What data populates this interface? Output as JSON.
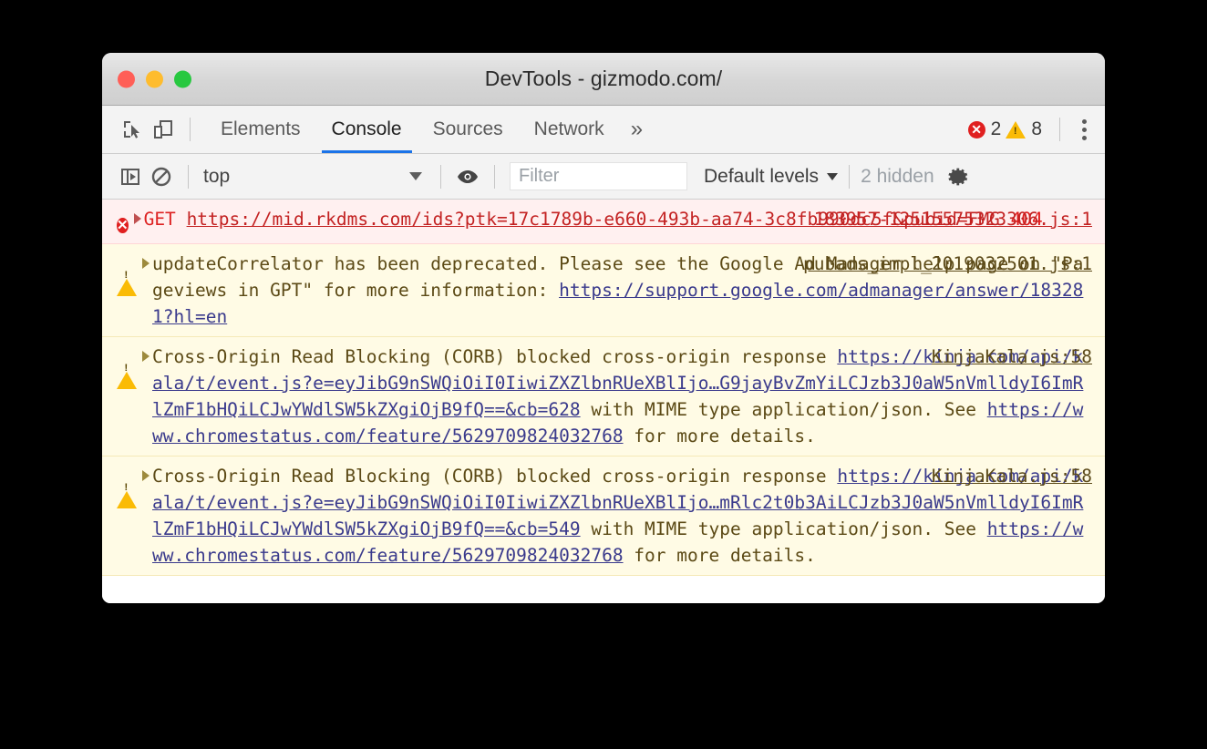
{
  "window": {
    "title": "DevTools - gizmodo.com/",
    "traffic_lights": [
      {
        "name": "close",
        "color": "#ff5f57"
      },
      {
        "name": "minimize",
        "color": "#febc2e"
      },
      {
        "name": "maximize",
        "color": "#28c840"
      }
    ]
  },
  "tabbar": {
    "inspect_icon": "inspect-element-icon",
    "device_icon": "device-toolbar-icon",
    "tabs": [
      {
        "label": "Elements",
        "active": false
      },
      {
        "label": "Console",
        "active": true
      },
      {
        "label": "Sources",
        "active": false
      },
      {
        "label": "Network",
        "active": false
      }
    ],
    "more_tabs_label": "»",
    "error_count": "2",
    "warning_count": "8",
    "error_badge_color": "#e02020",
    "warning_badge_color": "#fabb05",
    "menu_icon": "kebab-menu-icon",
    "active_tab_underline_color": "#1a73e8"
  },
  "consolebar": {
    "sidebar_icon": "show-console-sidebar-icon",
    "clear_icon": "clear-console-icon",
    "context": "top",
    "live_expression_icon": "eye-icon",
    "filter_placeholder": "Filter",
    "filter_value": "",
    "levels_label": "Default levels",
    "hidden_label": "2 hidden",
    "settings_icon": "gear-icon"
  },
  "console_messages": [
    {
      "level": "error",
      "icon": "error-circle-icon",
      "expander": "disclosure-triangle-icon",
      "method": "GET",
      "url": "https://mid.rkdms.com/ids?ptk=17c1789b-e660-493b-aa74-3c8fb990dc5f&pubid=FMG",
      "status": "404",
      "source": "183957-12515575323306.js:1",
      "background": "#fff0f0"
    },
    {
      "level": "warning",
      "icon": "warning-triangle-icon",
      "expander": "disclosure-triangle-icon",
      "text_before": "updateCorrelator has been deprecated. Please see the Google Ad Manager help page on \"Pageviews in GPT\" for more information: ",
      "url": "https://support.google.com/admanager/answer/183281?hl=en",
      "text_after": "",
      "source": "pubads_impl_2019032501.js:1",
      "background": "#fffbe5"
    },
    {
      "level": "warning",
      "icon": "warning-triangle-icon",
      "expander": "disclosure-triangle-icon",
      "text_before": "Cross-Origin Read Blocking (CORB) blocked cross-origin response ",
      "url": "https://kinja.com/api/kala/t/event.js?e=eyJibG9nSWQiOiI0IiwiZXZlbnRUeXBlIjo…G9jayBvZmYiLCJzb3J0aW5nVmlldyI6ImRlZmF1bHQiLCJwYWdlSW5kZXgiOjB9fQ==&cb=628",
      "text_mid": " with MIME type application/json. See ",
      "url2": "https://www.chromestatus.com/feature/5629709824032768",
      "text_after": " for more details.",
      "source": "KinjaKala.js:58",
      "background": "#fffbe5"
    },
    {
      "level": "warning",
      "icon": "warning-triangle-icon",
      "expander": "disclosure-triangle-icon",
      "text_before": "Cross-Origin Read Blocking (CORB) blocked cross-origin response ",
      "url": "https://kinja.com/api/kala/t/event.js?e=eyJibG9nSWQiOiI0IiwiZXZlbnRUeXBlIjo…mRlc2t0b3AiLCJzb3J0aW5nVmlldyI6ImRlZmF1bHQiLCJwYWdlSW5kZXgiOjB9fQ==&cb=549",
      "text_mid": " with MIME type application/json. See ",
      "url2": "https://www.chromestatus.com/feature/5629709824032768",
      "text_after": " for more details.",
      "source": "KinjaKala.js:58",
      "background": "#fffbe5"
    }
  ]
}
